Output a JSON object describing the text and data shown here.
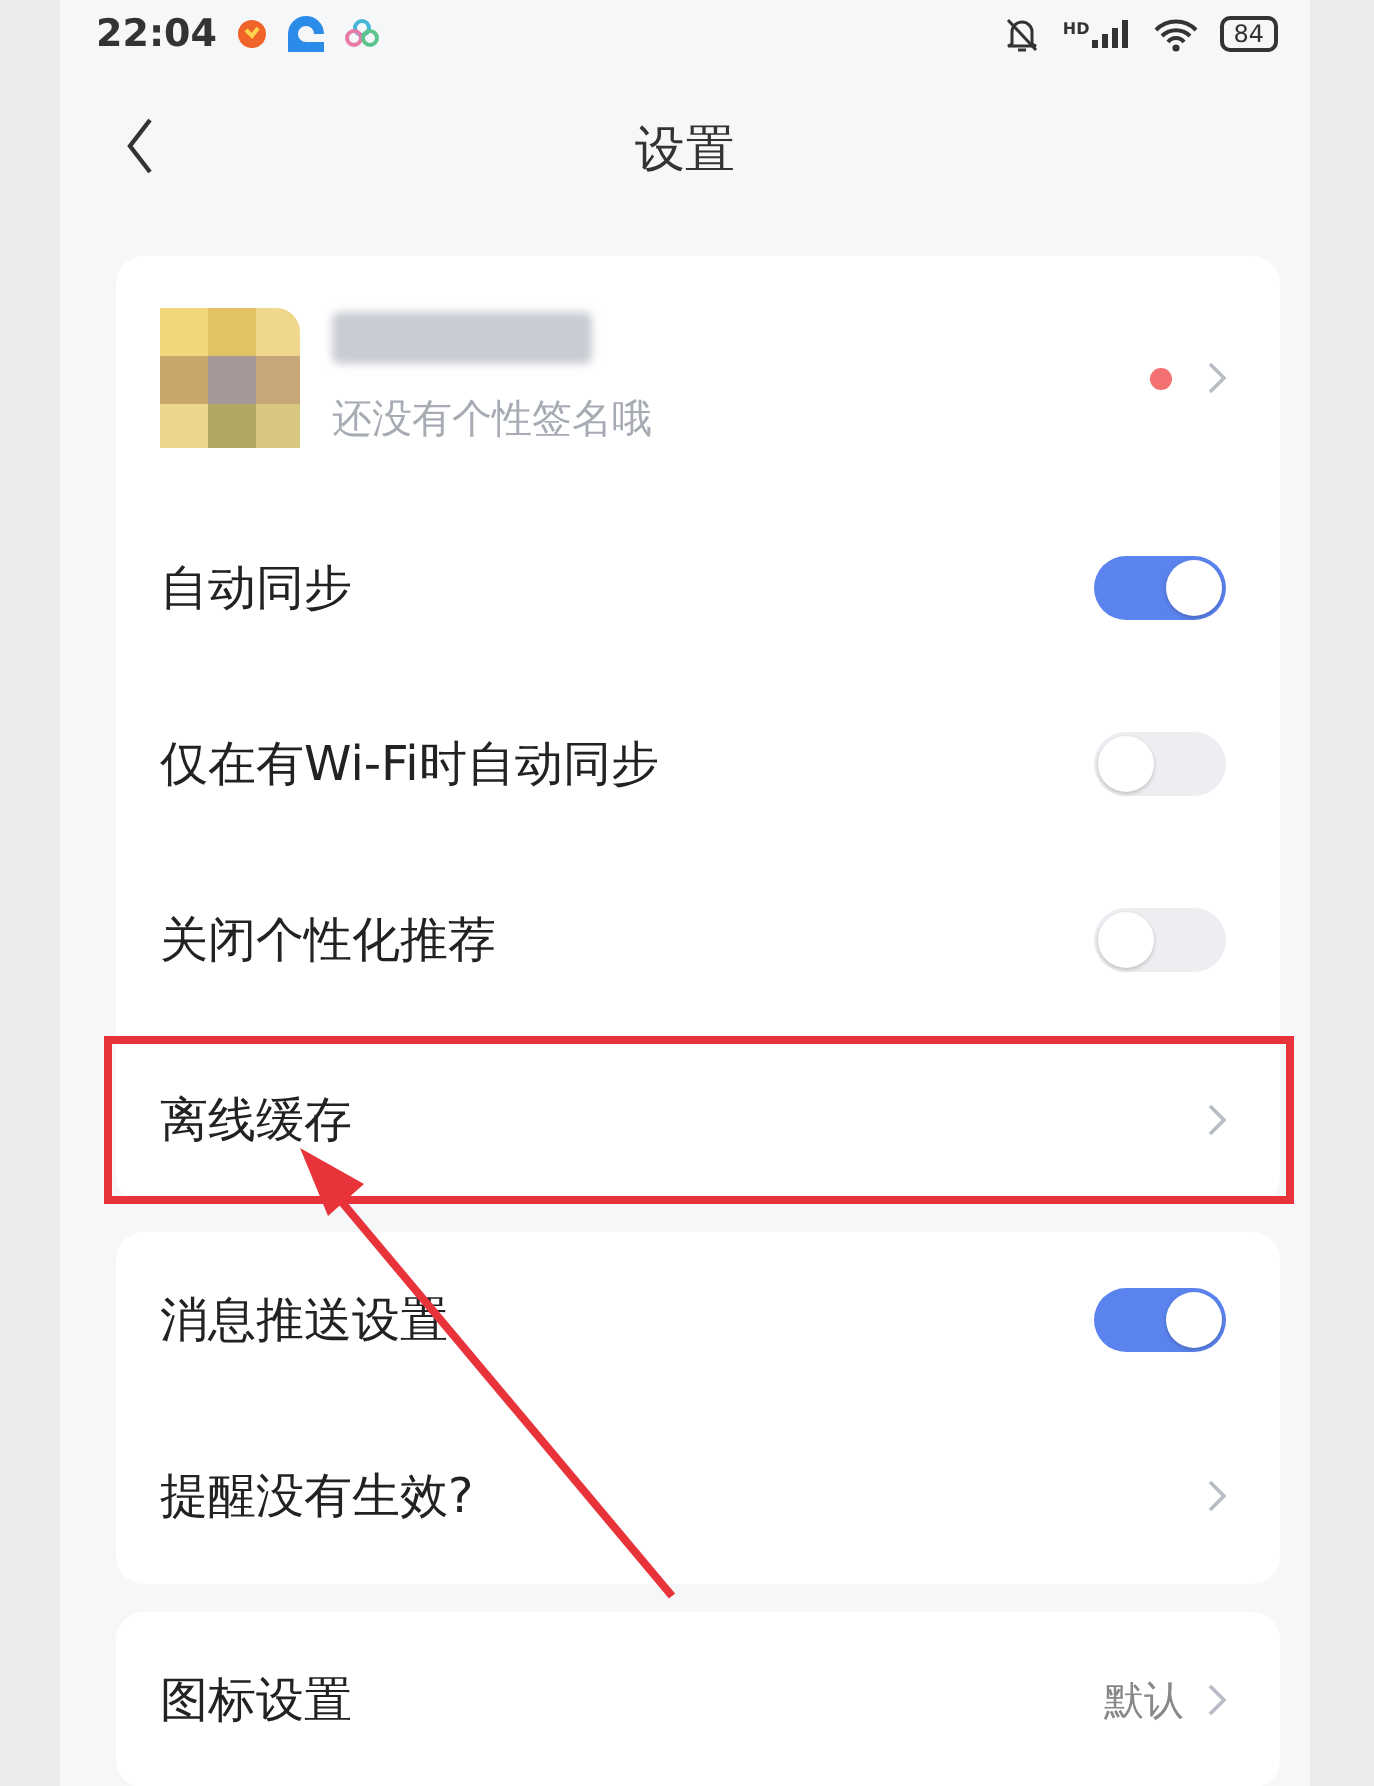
{
  "status_bar": {
    "time": "22:04",
    "network_label": "HD",
    "battery": "84"
  },
  "header": {
    "title": "设置"
  },
  "groups": [
    {
      "items": [
        {
          "kind": "profile",
          "signature": "还没有个性签名哦",
          "unread": true
        },
        {
          "kind": "toggle",
          "label": "自动同步",
          "on": true
        },
        {
          "kind": "toggle",
          "label": "仅在有Wi-Fi时自动同步",
          "on": false
        },
        {
          "kind": "toggle",
          "label": "关闭个性化推荐",
          "on": false
        },
        {
          "kind": "link",
          "label": "离线缓存",
          "highlighted": true
        }
      ]
    },
    {
      "items": [
        {
          "kind": "toggle",
          "label": "消息推送设置",
          "on": true
        },
        {
          "kind": "link",
          "label": "提醒没有生效?"
        }
      ]
    },
    {
      "items": [
        {
          "kind": "link",
          "label": "图标设置",
          "value": "默认"
        }
      ]
    }
  ]
}
